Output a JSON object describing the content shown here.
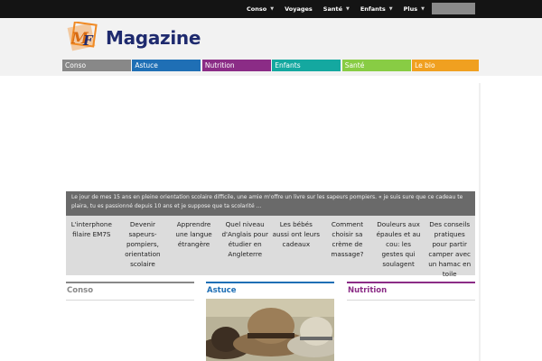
{
  "topnav": {
    "items": [
      {
        "label": "Conso",
        "caret": "▼"
      },
      {
        "label": "Voyages",
        "caret": ""
      },
      {
        "label": "Santé",
        "caret": "▼"
      },
      {
        "label": "Enfants",
        "caret": "▼"
      },
      {
        "label": "Plus",
        "caret": "▼"
      }
    ],
    "search_placeholder": ""
  },
  "header": {
    "logo_text": "Magazine",
    "logo_icon": "magazine-logo-icon"
  },
  "categories": [
    {
      "label": "Conso",
      "color": "#888888"
    },
    {
      "label": "Astuce",
      "color": "#1f6fb5"
    },
    {
      "label": "Nutrition",
      "color": "#8b2c86"
    },
    {
      "label": "Enfants",
      "color": "#14a8a0"
    },
    {
      "label": "Santé",
      "color": "#88cc44"
    },
    {
      "label": "Le bio",
      "color": "#f0a020"
    }
  ],
  "slider": {
    "caption": "Le jour de mes 15 ans en pleine orientation scolaire difficile, une amie m'offre un livre sur les sapeurs pompiers. « je suis sure que ce cadeau te plaira, tu es passionné depuis 10 ans et je suppose que ta scolarité  ...",
    "thumbs": [
      "L'interphone filaire EM7S",
      "Devenir sapeurs-pompiers, orientation scolaire",
      "Apprendre une langue étrangère",
      "Quel niveau d'Anglais pour étudier en Angleterre",
      "Les bébés aussi ont leurs cadeaux",
      "Comment choisir sa crème de massage?",
      "Douleurs aux épaules et au cou: les gestes qui soulagent",
      "Des conseils pratiques pour partir camper avec un hamac en toile"
    ]
  },
  "sections": [
    {
      "title": "Conso",
      "color": "#888888"
    },
    {
      "title": "Astuce",
      "color": "#1f6fb5"
    },
    {
      "title": "Nutrition",
      "color": "#8b2c86"
    }
  ],
  "colors": {
    "topbar": "#141414",
    "header_bg": "#f2f2f2",
    "logo_blue": "#1e2a6e",
    "logo_orange": "#f08a24"
  }
}
